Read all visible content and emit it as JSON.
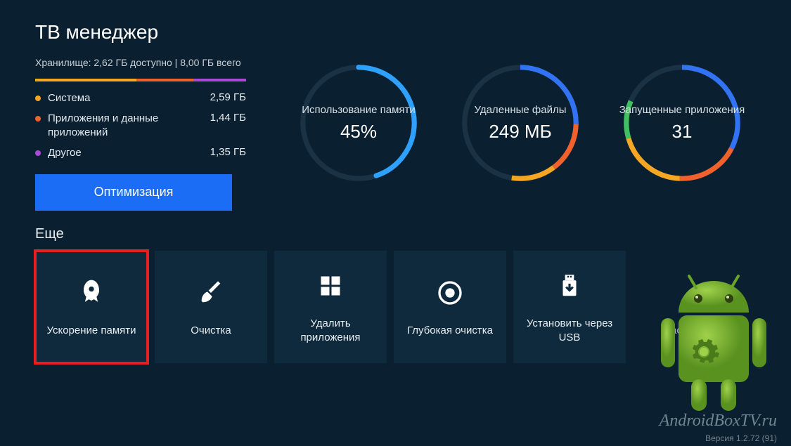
{
  "title": "ТВ менеджер",
  "storage": {
    "summary": "Хранилище: 2,62 ГБ доступно | 8,00 ГБ всего",
    "legend": [
      {
        "label": "Система",
        "value": "2,59 ГБ"
      },
      {
        "label": "Приложения и данные приложений",
        "value": "1,44 ГБ"
      },
      {
        "label": "Другое",
        "value": "1,35 ГБ"
      }
    ]
  },
  "optimize_label": "Оптимизация",
  "gauges": {
    "memory": {
      "label": "Использование памяти",
      "value": "45%"
    },
    "deleted": {
      "label": "Удаленные файлы",
      "value": "249 МБ"
    },
    "running": {
      "label": "Запущенные приложения",
      "value": "31"
    }
  },
  "chart_data": [
    {
      "type": "bar",
      "title": "Хранилище",
      "categories": [
        "Система",
        "Приложения и данные приложений",
        "Другое",
        "Доступно"
      ],
      "values": [
        2.59,
        1.44,
        1.35,
        2.62
      ],
      "unit": "ГБ",
      "total": 8.0
    },
    {
      "type": "pie",
      "title": "Использование памяти",
      "values": [
        45,
        55
      ],
      "unit": "%"
    }
  ],
  "more_label": "Еще",
  "tiles": {
    "boost": "Ускорение памяти",
    "clean": "Очистка",
    "uninstall": "Удалить приложения",
    "deep": "Глубокая очистка",
    "usb": "Установить через USB",
    "settings": "Настройки"
  },
  "watermark": "AndroidBoxTV.ru",
  "version": "Версия 1.2.72 (91)"
}
